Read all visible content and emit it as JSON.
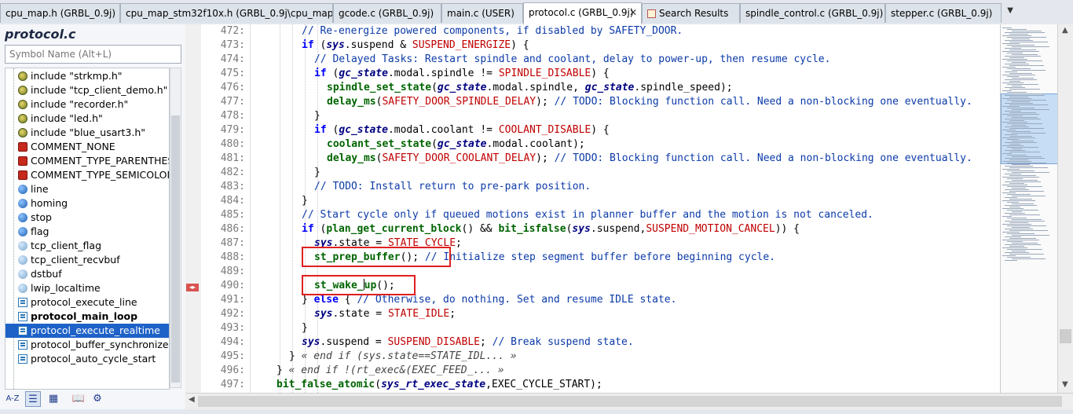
{
  "tabs": [
    {
      "label": "cpu_map.h (GRBL_0.9j)",
      "active": false
    },
    {
      "label": "cpu_map_stm32f10x.h (GRBL_0.9j\\cpu_map)",
      "active": false
    },
    {
      "label": "gcode.c (GRBL_0.9j)",
      "active": false
    },
    {
      "label": "main.c (USER)",
      "active": false
    },
    {
      "label": "protocol.c (GRBL_0.9j)",
      "active": true,
      "close": "✕"
    },
    {
      "label": "Search Results",
      "active": false
    },
    {
      "label": "spindle_control.c (GRBL_0.9j)",
      "active": false
    },
    {
      "label": "stepper.c (GRBL_0.9j)",
      "active": false
    }
  ],
  "tab_dropdown_icon": "chevron-down-icon",
  "symbols": {
    "title": "protocol.c",
    "search_placeholder": "Symbol Name (Alt+L)",
    "items": [
      {
        "icon": "include",
        "label": "include \"strkmp.h\""
      },
      {
        "icon": "include",
        "label": "include \"tcp_client_demo.h\""
      },
      {
        "icon": "include",
        "label": "include \"recorder.h\""
      },
      {
        "icon": "include",
        "label": "include \"led.h\""
      },
      {
        "icon": "include",
        "label": "include \"blue_usart3.h\""
      },
      {
        "icon": "macro",
        "label": "COMMENT_NONE"
      },
      {
        "icon": "macro",
        "label": "COMMENT_TYPE_PARENTHES"
      },
      {
        "icon": "macro",
        "label": "COMMENT_TYPE_SEMICOLON"
      },
      {
        "icon": "var",
        "label": "line"
      },
      {
        "icon": "var",
        "label": "homing"
      },
      {
        "icon": "var",
        "label": "stop"
      },
      {
        "icon": "var",
        "label": "flag"
      },
      {
        "icon": "var-light",
        "label": "tcp_client_flag"
      },
      {
        "icon": "var-light",
        "label": "tcp_client_recvbuf"
      },
      {
        "icon": "var-light",
        "label": "dstbuf"
      },
      {
        "icon": "var-light",
        "label": "lwip_localtime"
      },
      {
        "icon": "func",
        "label": "protocol_execute_line"
      },
      {
        "icon": "func",
        "label": "protocol_main_loop",
        "bold": true
      },
      {
        "icon": "func",
        "label": "protocol_execute_realtime",
        "selected": true
      },
      {
        "icon": "func",
        "label": "protocol_buffer_synchronize"
      },
      {
        "icon": "func",
        "label": "protocol_auto_cycle_start"
      }
    ],
    "toolbar": [
      {
        "name": "sort-az-icon",
        "label": "A-Z"
      },
      {
        "name": "list-view-icon",
        "label": "☰",
        "selected": true
      },
      {
        "name": "category-view-icon",
        "label": "▦"
      },
      {
        "name": "book-icon",
        "label": "📖"
      },
      {
        "name": "settings-gear-icon",
        "label": "⚙"
      }
    ]
  },
  "editor": {
    "line_numbers": [
      "472:",
      "473:",
      "474:",
      "475:",
      "476:",
      "477:",
      "478:",
      "479:",
      "480:",
      "481:",
      "482:",
      "483:",
      "484:",
      "485:",
      "486:",
      "487:",
      "488:",
      "489:",
      "490:",
      "491:",
      "492:",
      "493:",
      "494:",
      "495:",
      "496:",
      "497:"
    ],
    "lines": [
      {
        "indent": 3,
        "tokens": [
          {
            "t": "cmt",
            "v": "// Re-energize powered components, if disabled by SAFETY_DOOR."
          }
        ]
      },
      {
        "indent": 3,
        "tokens": [
          {
            "t": "kw",
            "v": "if"
          },
          {
            "t": "op",
            "v": " ("
          },
          {
            "t": "var",
            "v": "sys"
          },
          {
            "t": "op",
            "v": ".suspend & "
          },
          {
            "t": "mac",
            "v": "SUSPEND_ENERGIZE"
          },
          {
            "t": "op",
            "v": ") {"
          }
        ]
      },
      {
        "indent": 4,
        "tokens": [
          {
            "t": "cmt",
            "v": "// Delayed Tasks: Restart spindle and coolant, delay to power-up, then resume cycle."
          }
        ]
      },
      {
        "indent": 4,
        "tokens": [
          {
            "t": "kw",
            "v": "if"
          },
          {
            "t": "op",
            "v": " ("
          },
          {
            "t": "var",
            "v": "gc_state"
          },
          {
            "t": "op",
            "v": ".modal.spindle != "
          },
          {
            "t": "mac",
            "v": "SPINDLE_DISABLE"
          },
          {
            "t": "op",
            "v": ") {"
          }
        ]
      },
      {
        "indent": 5,
        "tokens": [
          {
            "t": "fncall",
            "v": "spindle_set_state"
          },
          {
            "t": "op",
            "v": "("
          },
          {
            "t": "var",
            "v": "gc_state"
          },
          {
            "t": "op",
            "v": ".modal.spindle, "
          },
          {
            "t": "var",
            "v": "gc_state"
          },
          {
            "t": "op",
            "v": ".spindle_speed);"
          }
        ]
      },
      {
        "indent": 5,
        "tokens": [
          {
            "t": "fncall",
            "v": "delay_ms"
          },
          {
            "t": "op",
            "v": "("
          },
          {
            "t": "mac",
            "v": "SAFETY_DOOR_SPINDLE_DELAY"
          },
          {
            "t": "op",
            "v": "); "
          },
          {
            "t": "cmt",
            "v": "// TODO: Blocking function call. Need a non-blocking one eventually."
          }
        ]
      },
      {
        "indent": 4,
        "tokens": [
          {
            "t": "op",
            "v": "}"
          }
        ]
      },
      {
        "indent": 4,
        "tokens": [
          {
            "t": "kw",
            "v": "if"
          },
          {
            "t": "op",
            "v": " ("
          },
          {
            "t": "var",
            "v": "gc_state"
          },
          {
            "t": "op",
            "v": ".modal.coolant != "
          },
          {
            "t": "mac",
            "v": "COOLANT_DISABLE"
          },
          {
            "t": "op",
            "v": ") {"
          }
        ]
      },
      {
        "indent": 5,
        "tokens": [
          {
            "t": "fncall",
            "v": "coolant_set_state"
          },
          {
            "t": "op",
            "v": "("
          },
          {
            "t": "var",
            "v": "gc_state"
          },
          {
            "t": "op",
            "v": ".modal.coolant);"
          }
        ]
      },
      {
        "indent": 5,
        "tokens": [
          {
            "t": "fncall",
            "v": "delay_ms"
          },
          {
            "t": "op",
            "v": "("
          },
          {
            "t": "mac",
            "v": "SAFETY_DOOR_COOLANT_DELAY"
          },
          {
            "t": "op",
            "v": "); "
          },
          {
            "t": "cmt",
            "v": "// TODO: Blocking function call. Need a non-blocking one eventually."
          }
        ]
      },
      {
        "indent": 4,
        "tokens": [
          {
            "t": "op",
            "v": "}"
          }
        ]
      },
      {
        "indent": 4,
        "tokens": [
          {
            "t": "cmt",
            "v": "// TODO: Install return to pre-park position."
          }
        ]
      },
      {
        "indent": 3,
        "tokens": [
          {
            "t": "op",
            "v": "}"
          }
        ]
      },
      {
        "indent": 3,
        "tokens": [
          {
            "t": "cmt",
            "v": "// Start cycle only if queued motions exist in planner buffer and the motion is not canceled."
          }
        ]
      },
      {
        "indent": 3,
        "tokens": [
          {
            "t": "kw",
            "v": "if"
          },
          {
            "t": "op",
            "v": " ("
          },
          {
            "t": "fncall",
            "v": "plan_get_current_block"
          },
          {
            "t": "op",
            "v": "() && "
          },
          {
            "t": "fncall",
            "v": "bit_isfalse"
          },
          {
            "t": "op",
            "v": "("
          },
          {
            "t": "var",
            "v": "sys"
          },
          {
            "t": "op",
            "v": ".suspend,"
          },
          {
            "t": "mac",
            "v": "SUSPEND_MOTION_CANCEL"
          },
          {
            "t": "op",
            "v": ")) {"
          }
        ]
      },
      {
        "indent": 4,
        "tokens": [
          {
            "t": "var",
            "v": "sys"
          },
          {
            "t": "op",
            "v": ".state = "
          },
          {
            "t": "mac",
            "v": "STATE_CYCLE"
          },
          {
            "t": "op",
            "v": ";"
          }
        ]
      },
      {
        "indent": 4,
        "tokens": [
          {
            "t": "fncall",
            "v": "st_prep_buffer"
          },
          {
            "t": "op",
            "v": "(); "
          },
          {
            "t": "cmt",
            "v": "// Initialize step segment buffer before beginning cycle."
          }
        ]
      },
      {
        "indent": 4,
        "tokens": []
      },
      {
        "indent": 4,
        "tokens": [
          {
            "t": "fncall",
            "v": "st_wake_"
          },
          {
            "t": "caret",
            "v": ""
          },
          {
            "t": "fncall",
            "v": "up"
          },
          {
            "t": "op",
            "v": "();"
          }
        ]
      },
      {
        "indent": 3,
        "tokens": [
          {
            "t": "op",
            "v": "} "
          },
          {
            "t": "kw",
            "v": "else"
          },
          {
            "t": "op",
            "v": " { "
          },
          {
            "t": "cmt",
            "v": "// Otherwise, do nothing. Set and resume IDLE state."
          }
        ]
      },
      {
        "indent": 4,
        "tokens": [
          {
            "t": "var",
            "v": "sys"
          },
          {
            "t": "op",
            "v": ".state = "
          },
          {
            "t": "mac",
            "v": "STATE_IDLE"
          },
          {
            "t": "op",
            "v": ";"
          }
        ]
      },
      {
        "indent": 3,
        "tokens": [
          {
            "t": "op",
            "v": "}"
          }
        ]
      },
      {
        "indent": 3,
        "tokens": [
          {
            "t": "var",
            "v": "sys"
          },
          {
            "t": "op",
            "v": ".suspend = "
          },
          {
            "t": "mac",
            "v": "SUSPEND_DISABLE"
          },
          {
            "t": "op",
            "v": "; "
          },
          {
            "t": "cmt",
            "v": "// Break suspend state."
          }
        ]
      },
      {
        "indent": 2,
        "tokens": [
          {
            "t": "op",
            "v": "} "
          },
          {
            "t": "fold",
            "v": "« end if (sys.state==STATE_IDL... »"
          }
        ]
      },
      {
        "indent": 1,
        "tokens": [
          {
            "t": "op",
            "v": "} "
          },
          {
            "t": "fold",
            "v": "« end if !(rt_exec&(EXEC_FEED_... »"
          }
        ]
      },
      {
        "indent": 1,
        "tokens": [
          {
            "t": "fncall",
            "v": "bit_false_atomic"
          },
          {
            "t": "op",
            "v": "("
          },
          {
            "t": "var",
            "v": "sys_rt_exec_state"
          },
          {
            "t": "op",
            "v": ",EXEC_CYCLE_START);"
          }
        ]
      }
    ]
  },
  "gutter_marker_icon": "bookmark-arrow-icon",
  "colors": {
    "selection": "#1e62c8",
    "highlight_box": "#e02020",
    "minimap_view": "#c6ddf5"
  }
}
